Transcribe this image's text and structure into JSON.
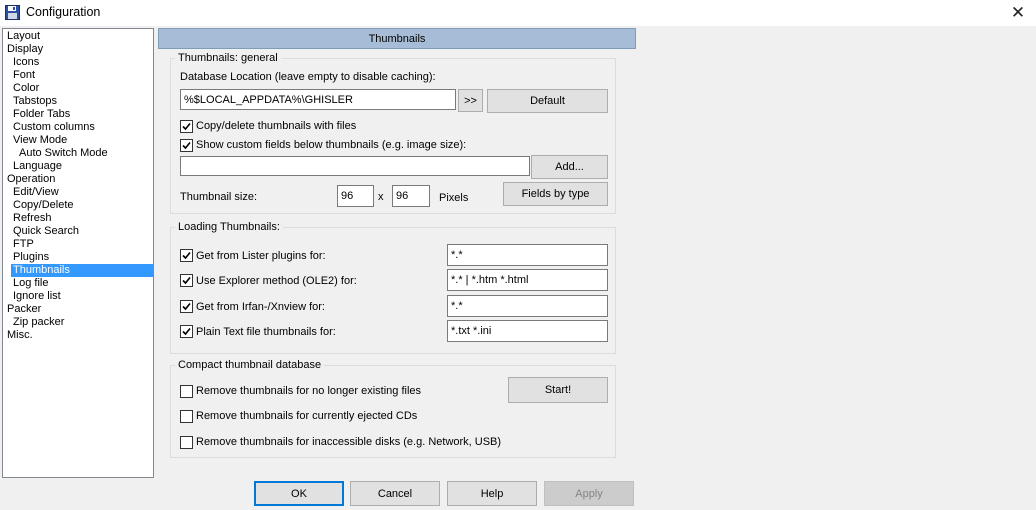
{
  "window": {
    "title": "Configuration",
    "close_glyph": "✕"
  },
  "tree": [
    {
      "label": "Layout",
      "indent": 0
    },
    {
      "label": "Display",
      "indent": 0
    },
    {
      "label": "Icons",
      "indent": 1
    },
    {
      "label": "Font",
      "indent": 1
    },
    {
      "label": "Color",
      "indent": 1
    },
    {
      "label": "Tabstops",
      "indent": 1
    },
    {
      "label": "Folder Tabs",
      "indent": 1
    },
    {
      "label": "Custom columns",
      "indent": 1
    },
    {
      "label": "View Mode",
      "indent": 1
    },
    {
      "label": "Auto Switch Mode",
      "indent": 2
    },
    {
      "label": "Language",
      "indent": 1
    },
    {
      "label": "Operation",
      "indent": 0
    },
    {
      "label": "Edit/View",
      "indent": 1
    },
    {
      "label": "Copy/Delete",
      "indent": 1
    },
    {
      "label": "Refresh",
      "indent": 1
    },
    {
      "label": "Quick Search",
      "indent": 1
    },
    {
      "label": "FTP",
      "indent": 1
    },
    {
      "label": "Plugins",
      "indent": 1
    },
    {
      "label": "Thumbnails",
      "indent": 1,
      "selected": true
    },
    {
      "label": "Log file",
      "indent": 1
    },
    {
      "label": "Ignore list",
      "indent": 1
    },
    {
      "label": "Packer",
      "indent": 0
    },
    {
      "label": "Zip packer",
      "indent": 1
    },
    {
      "label": "Misc.",
      "indent": 0
    }
  ],
  "panel": {
    "title": "Thumbnails",
    "general": {
      "title": "Thumbnails: general",
      "db_label": "Database Location (leave empty to disable caching):",
      "db_value": "%$LOCAL_APPDATA%\\GHISLER",
      "browse_label": ">>",
      "default_label": "Default",
      "copy_delete_label": "Copy/delete thumbnails with files",
      "copy_delete_checked": true,
      "custom_fields_label": "Show custom fields below thumbnails (e.g. image size):",
      "custom_fields_checked": true,
      "custom_fields_value": "",
      "add_label": "Add...",
      "size_label": "Thumbnail size:",
      "width_value": "96",
      "x_label": "x",
      "height_value": "96",
      "pixels_label": "Pixels",
      "fields_by_type_label": "Fields by type"
    },
    "loading": {
      "title": "Loading Thumbnails:",
      "rows": [
        {
          "label": "Get from Lister plugins for:",
          "checked": true,
          "value": "*.*"
        },
        {
          "label": "Use Explorer method (OLE2) for:",
          "checked": true,
          "value": "*.* | *.htm *.html"
        },
        {
          "label": "Get from Irfan-/Xnview for:",
          "checked": true,
          "value": "*.*"
        },
        {
          "label": "Plain Text file thumbnails for:",
          "checked": true,
          "value": "*.txt *.ini"
        }
      ]
    },
    "compact": {
      "title": "Compact thumbnail database",
      "rows": [
        {
          "label": "Remove thumbnails for no longer existing files",
          "checked": false
        },
        {
          "label": "Remove thumbnails for currently ejected CDs",
          "checked": false
        },
        {
          "label": "Remove thumbnails for inaccessible disks (e.g. Network, USB)",
          "checked": false
        }
      ],
      "start_label": "Start!"
    }
  },
  "footer": {
    "ok": "OK",
    "cancel": "Cancel",
    "help": "Help",
    "apply": "Apply"
  }
}
